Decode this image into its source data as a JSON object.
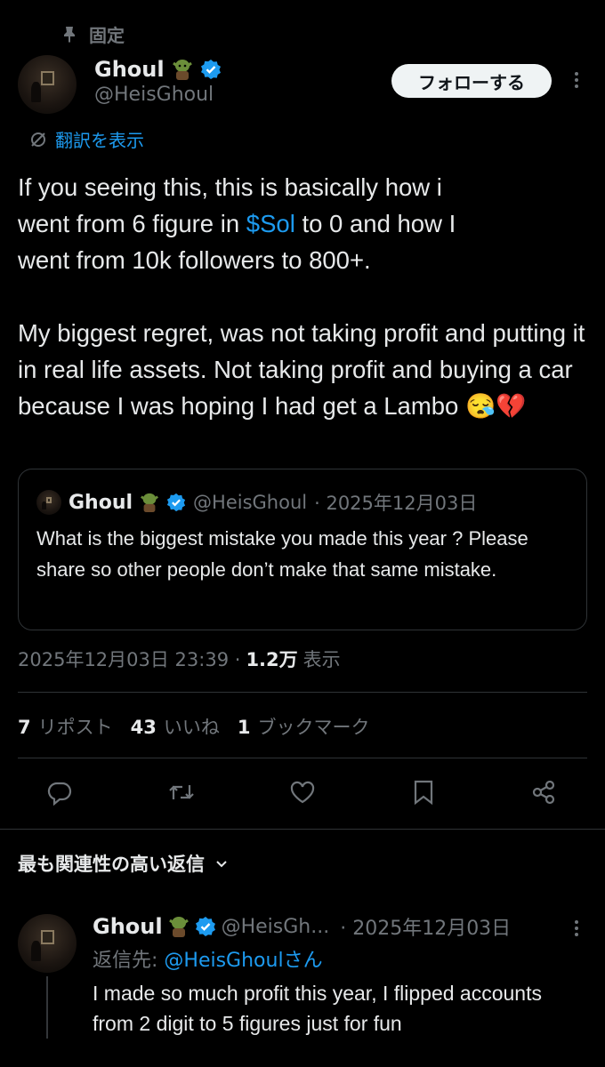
{
  "pinned": {
    "label": "固定"
  },
  "author": {
    "name": "Ghoul",
    "handle": "@HeisGhoul"
  },
  "follow_label": "フォローする",
  "translate_label": "翻訳を表示",
  "tweet": {
    "line1_a": "If you seeing this, this is basically how i",
    "line2_a": "went from 6 figure in ",
    "cashtag": "$Sol",
    "line2_b": " to 0 and how I",
    "line3": "went from 10k followers to 800+.",
    "para2": "My biggest regret, was not taking profit and putting it in real life assets. Not taking profit and buying a car because I was hoping I had get a Lambo",
    "emoji": "😪💔"
  },
  "quote": {
    "name": "Ghoul",
    "handle": "@HeisGhoul",
    "date": "· 2025年12月03日",
    "text": "What is the biggest mistake you made this year ? Please share so other people don’t make that same mistake."
  },
  "meta": {
    "timestamp": "2025年12月03日 23:39 ·",
    "views": "1.2万",
    "views_label": "表示"
  },
  "stats": {
    "reposts": "7",
    "reposts_label": "リポスト",
    "likes": "43",
    "likes_label": "いいね",
    "bookmarks": "1",
    "bookmarks_label": "ブックマーク"
  },
  "icons": [
    "reply-icon",
    "repost-icon",
    "like-icon",
    "bookmark-icon",
    "share-icon"
  ],
  "relevant_label": "最も関連性の高い返信",
  "reply": {
    "name": "Ghoul",
    "handle": "@HeisGh...",
    "date": "· 2025年12月03日",
    "reply_to_prefix": "返信先: ",
    "reply_to_handle": "@HeisGhoulさん",
    "text": "I made so much profit this year, I flipped accounts from 2 digit to 5 figures just for fun"
  },
  "colors": {
    "accent": "#1d9bf0",
    "background": "#000000",
    "muted": "#71767b",
    "text": "#e7e9ea",
    "border": "#2f3336"
  }
}
